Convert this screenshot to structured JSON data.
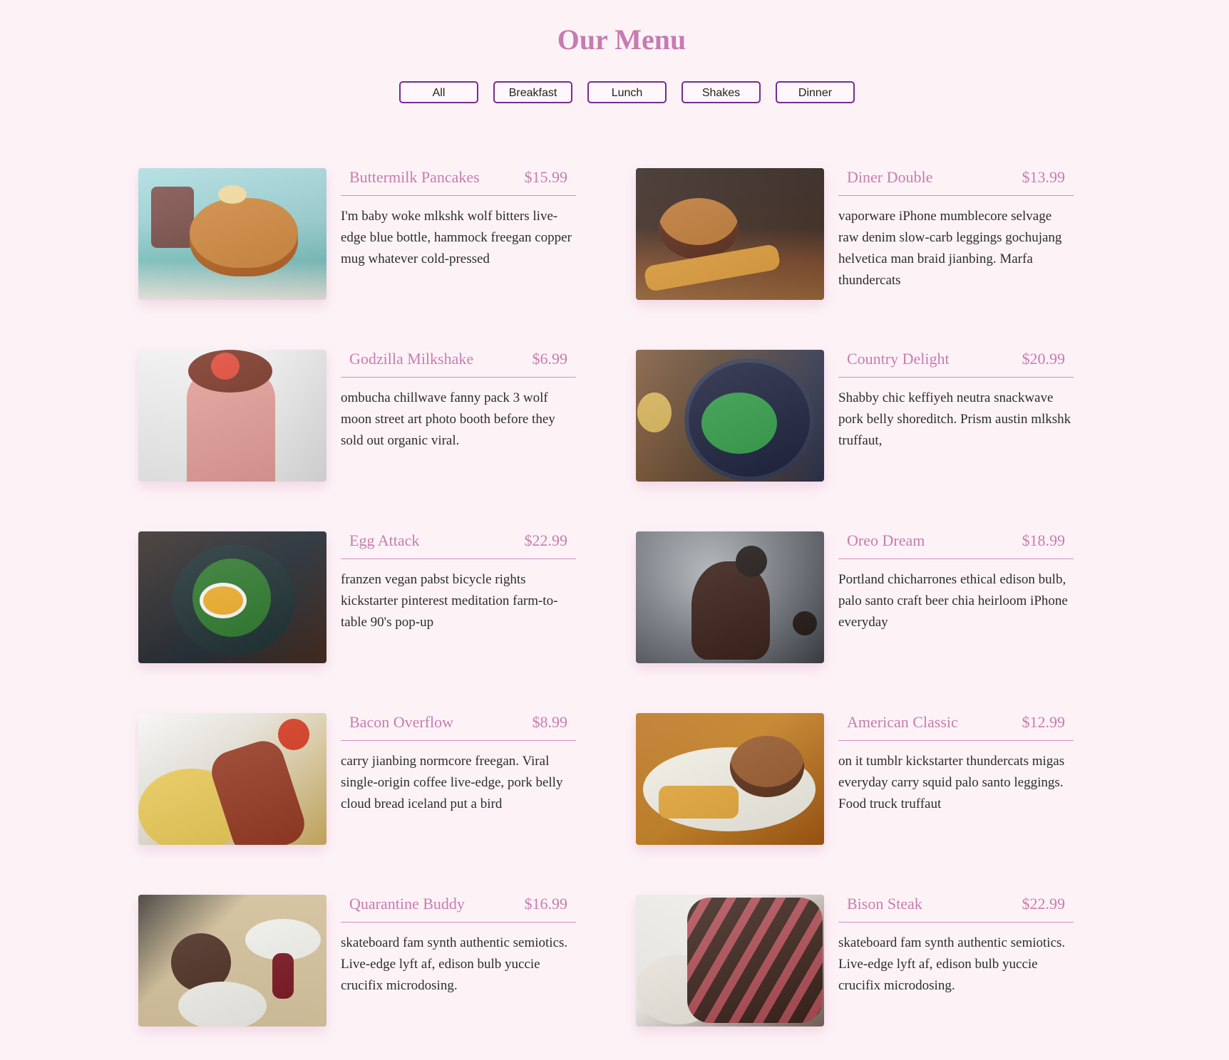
{
  "page": {
    "title": "Our Menu",
    "accent_color": "#c87bb0",
    "button_border_color": "#7a2a8f",
    "background_color": "#fdf3f7"
  },
  "filters": [
    "All",
    "Breakfast",
    "Lunch",
    "Shakes",
    "Dinner"
  ],
  "menu": [
    {
      "name": "Buttermilk Pancakes",
      "price": "$15.99",
      "desc": "I'm baby woke mlkshk wolf bitters live-edge blue bottle, hammock freegan copper mug whatever cold-pressed",
      "image_icon": "pancake-stack-photo"
    },
    {
      "name": "Diner Double",
      "price": "$13.99",
      "desc": "vaporware iPhone mumblecore selvage raw denim slow-carb leggings gochujang helvetica man braid jianbing. Marfa thundercats",
      "image_icon": "burger-fries-photo"
    },
    {
      "name": "Godzilla Milkshake",
      "price": "$6.99",
      "desc": "ombucha chillwave fanny pack 3 wolf moon street art photo booth before they sold out organic viral.",
      "image_icon": "strawberry-milkshake-photo"
    },
    {
      "name": "Country Delight",
      "price": "$20.99",
      "desc": "Shabby chic keffiyeh neutra snackwave pork belly shoreditch. Prism austin mlkshk truffaut,",
      "image_icon": "salad-bowl-photo"
    },
    {
      "name": "Egg Attack",
      "price": "$22.99",
      "desc": "franzen vegan pabst bicycle rights kickstarter pinterest meditation farm-to-table 90's pop-up",
      "image_icon": "egg-spinach-photo"
    },
    {
      "name": "Oreo Dream",
      "price": "$18.99",
      "desc": "Portland chicharrones ethical edison bulb, palo santo craft beer chia heirloom iPhone everyday",
      "image_icon": "oreo-shake-photo"
    },
    {
      "name": "Bacon Overflow",
      "price": "$8.99",
      "desc": "carry jianbing normcore freegan. Viral single-origin coffee live-edge, pork belly cloud bread iceland put a bird",
      "image_icon": "bacon-eggs-photo"
    },
    {
      "name": "American Classic",
      "price": "$12.99",
      "desc": "on it tumblr kickstarter thundercats migas everyday carry squid palo santo leggings. Food truck truffaut",
      "image_icon": "burger-plate-photo"
    },
    {
      "name": "Quarantine Buddy",
      "price": "$16.99",
      "desc": "skateboard fam synth authentic semiotics. Live-edge lyft af, edison bulb yuccie crucifix microdosing.",
      "image_icon": "dinner-table-photo"
    },
    {
      "name": "Bison Steak",
      "price": "$22.99",
      "desc": "skateboard fam synth authentic semiotics. Live-edge lyft af, edison bulb yuccie crucifix microdosing.",
      "image_icon": "steak-slices-photo"
    }
  ]
}
